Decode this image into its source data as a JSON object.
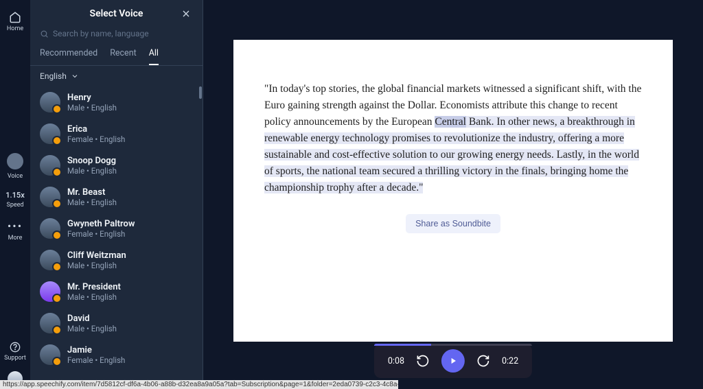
{
  "rail": {
    "home": "Home",
    "voice": "Voice",
    "speed": "1.15x",
    "speed_label": "Speed",
    "more": "More",
    "support": "Support"
  },
  "panel": {
    "title": "Select Voice",
    "search_placeholder": "Search by name, language",
    "tabs": {
      "recommended": "Recommended",
      "recent": "Recent",
      "all": "All"
    },
    "language": "English"
  },
  "voices": [
    {
      "name": "Henry",
      "meta": "Male • English"
    },
    {
      "name": "Erica",
      "meta": "Female • English"
    },
    {
      "name": "Snoop Dogg",
      "meta": "Male • English"
    },
    {
      "name": "Mr. Beast",
      "meta": "Male • English"
    },
    {
      "name": "Gwyneth Paltrow",
      "meta": "Female • English"
    },
    {
      "name": "Cliff Weitzman",
      "meta": "Male • English"
    },
    {
      "name": "Mr. President",
      "meta": "Male • English"
    },
    {
      "name": "David",
      "meta": "Male • English"
    },
    {
      "name": "Jamie",
      "meta": "Female • English"
    }
  ],
  "document": {
    "pre": "\"In today's top stories, the global financial markets witnessed a significant shift, with the Euro gaining strength against the Dollar. Economists attribute this change to recent policy announcements by the European ",
    "current_word": "Central",
    "post": " Bank. In other news, a breakthrough in renewable energy technology promises to revolutionize the industry, offering a more sustainable and cost-effective solution to our growing energy needs. Lastly, in the world of sports, the national team secured a thrilling victory in the finals, bringing home the championship trophy after a decade.\"",
    "share_label": "Share as Soundbite"
  },
  "player": {
    "elapsed": "0:08",
    "total": "0:22"
  },
  "status_url": "https://app.speechify.com/item/7d5812cf-df6a-4b06-a88b-d32ea8a9a05a?tab=Subscription&page=1&folder=2eda0739-c2c3-4c8a-9051-e690e5dcd655#"
}
